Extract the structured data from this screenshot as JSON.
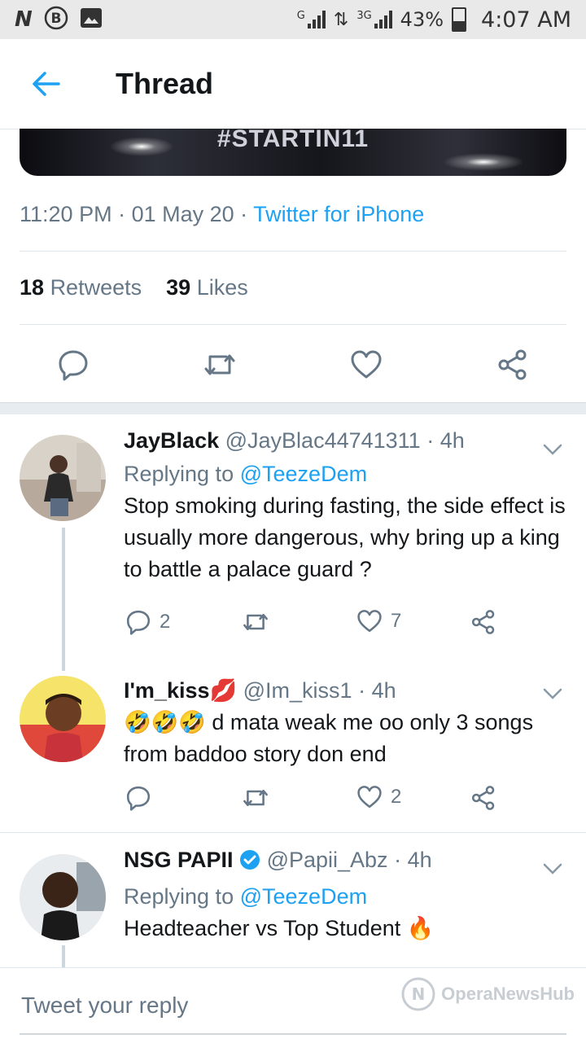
{
  "status_bar": {
    "icons": [
      "n-icon",
      "b-icon",
      "image-icon"
    ],
    "net1": "G",
    "net2": "3G",
    "battery": "43%",
    "time": "4:07 AM"
  },
  "header": {
    "title": "Thread"
  },
  "media": {
    "overlay_text": "#STARTIN11"
  },
  "tweet": {
    "time": "11:20 PM",
    "date": "01 May 20",
    "source": "Twitter for iPhone",
    "retweets_count": "18",
    "retweets_label": "Retweets",
    "likes_count": "39",
    "likes_label": "Likes"
  },
  "replies": [
    {
      "name": "JayBlack",
      "handle": "@JayBlac44741311",
      "age": "4h",
      "replying_label": "Replying to",
      "replying_to": "@TeezeDem",
      "text": "Stop smoking during fasting, the side effect is usually more dangerous,  why bring up a king to battle a palace guard ?",
      "reply_count": "2",
      "like_count": "7"
    },
    {
      "name": "I'm_kiss💋",
      "handle": "@Im_kiss1",
      "age": "4h",
      "text": "🤣🤣🤣 d mata weak me oo only 3 songs from baddoo story don end",
      "like_count": "2"
    },
    {
      "name": "NSG PAPII",
      "handle": "@Papii_Abz",
      "age": "4h",
      "replying_label": "Replying to",
      "replying_to": "@TeezeDem",
      "text": "Headteacher vs Top Student 🔥"
    }
  ],
  "composer": {
    "placeholder": "Tweet your reply"
  },
  "watermark": {
    "text": "OperaNewsHub"
  },
  "colors": {
    "accent": "#1da1f2",
    "muted": "#657786",
    "text": "#14171a",
    "divider": "#e1e8ed"
  }
}
